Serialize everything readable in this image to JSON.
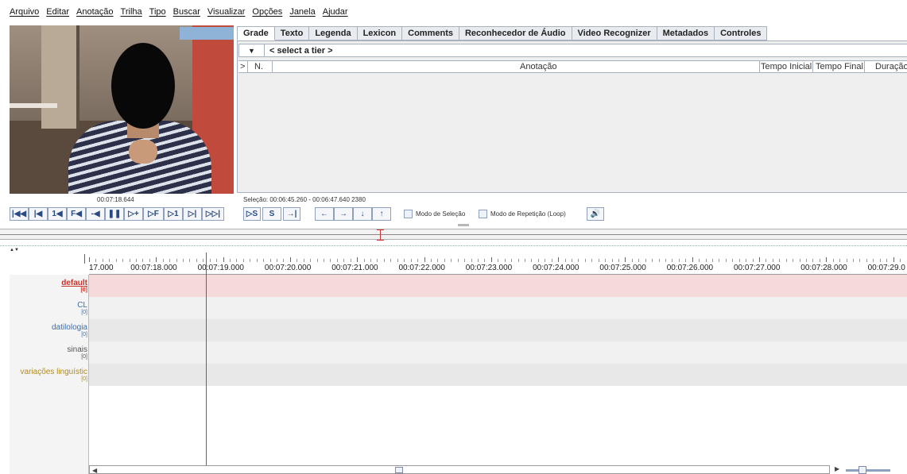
{
  "menu": [
    "Arquivo",
    "Editar",
    "Anotação",
    "Trilha",
    "Tipo",
    "Buscar",
    "Visualizar",
    "Opções",
    "Janela",
    "Ajudar"
  ],
  "tabs": [
    {
      "label": "Grade",
      "active": true
    },
    {
      "label": "Texto"
    },
    {
      "label": "Legenda"
    },
    {
      "label": "Lexicon"
    },
    {
      "label": "Comments"
    },
    {
      "label": "Reconhecedor de Áudio"
    },
    {
      "label": "Video Recognizer"
    },
    {
      "label": "Metadados"
    },
    {
      "label": "Controles"
    }
  ],
  "grid": {
    "tier_placeholder": "< select a tier >",
    "columns": {
      "arrow": ">",
      "n": "N.",
      "annotation": "Anotação",
      "start": "Tempo Inicial",
      "end": "Tempo Final",
      "duration": "Duração"
    }
  },
  "player": {
    "timecode": "00:07:18.644",
    "selection": "Seleção: 00:06:45.260 - 00:06:47.640  2380",
    "buttons": [
      "|◀◀",
      "|◀",
      "1◀",
      "F◀",
      "-◀",
      "❚❚",
      "▷+",
      "▷F",
      "▷1",
      "▷|",
      "▷▷|"
    ],
    "selection_buttons": [
      "▷S",
      "S",
      "→|"
    ],
    "nav_buttons": [
      "←",
      "→",
      "↓",
      "↑"
    ],
    "selection_mode": "Modo de Seleção",
    "loop_mode": "Modo de Repetição (Loop)",
    "speaker": "🔊"
  },
  "timeline": {
    "ruler_labels": [
      "17.000",
      "00:07:18.000",
      "00:07:19.000",
      "00:07:20.000",
      "00:07:21.000",
      "00:07:22.000",
      "00:07:23.000",
      "00:07:24.000",
      "00:07:25.000",
      "00:07:26.000",
      "00:07:27.000",
      "00:07:28.000",
      "00:07:29.0"
    ],
    "tiers": [
      {
        "name": "default",
        "count": "[0]",
        "color": "#c8342e",
        "bold": true,
        "row_color": "#f6dada"
      },
      {
        "name": "CL",
        "count": "[0]",
        "color": "#3a6fb0",
        "bold": false,
        "row_color": "#f1f1f1"
      },
      {
        "name": "datilologia",
        "count": "[0]",
        "color": "#3a6fb0",
        "bold": false,
        "row_color": "#e8e8e8"
      },
      {
        "name": "sinais",
        "count": "[0]",
        "color": "#555555",
        "bold": false,
        "row_color": "#f1f1f1"
      },
      {
        "name": "variações linguístic",
        "count": "[0]",
        "color": "#b08a20",
        "bold": false,
        "row_color": "#e8e8e8"
      }
    ]
  },
  "colors": {
    "accent": "#2b4a7f",
    "cursor": "#e03030"
  }
}
